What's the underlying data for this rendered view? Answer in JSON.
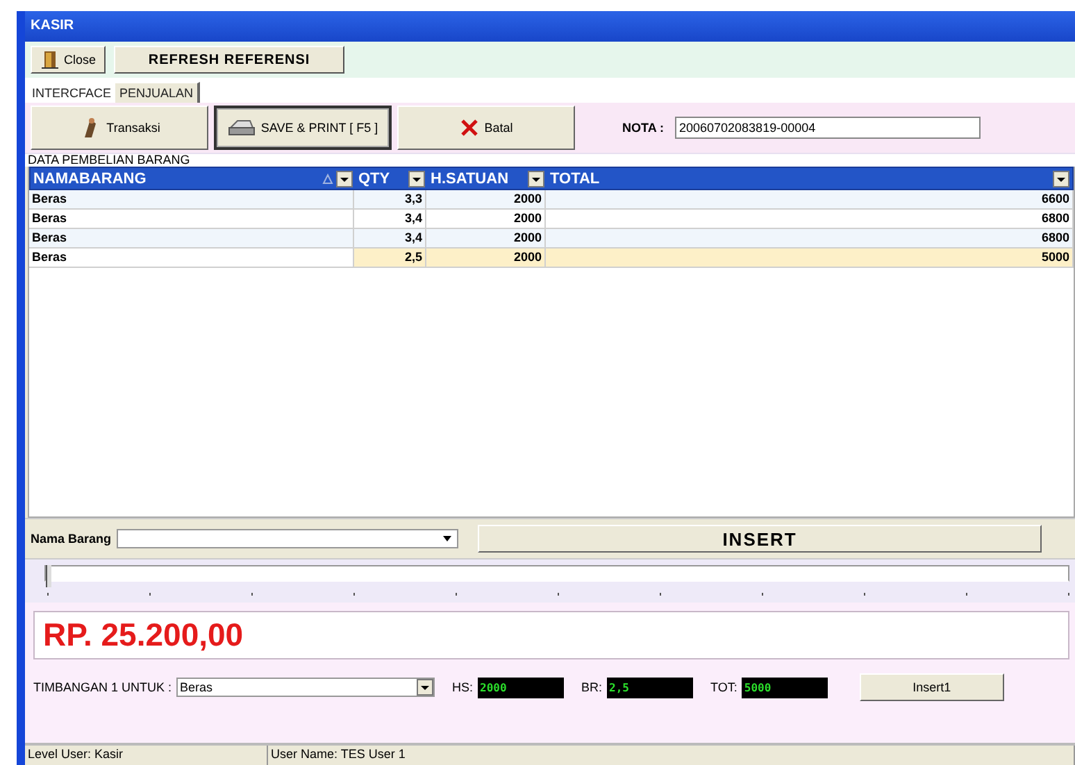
{
  "window": {
    "title": "KASIR"
  },
  "toolbar": [
    {
      "kind": "close",
      "label": "Close"
    },
    {
      "kind": "refresh",
      "label": "REFRESH REFERENSI"
    }
  ],
  "tabs": [
    {
      "label": "INTERCFACE",
      "selected": false
    },
    {
      "label": "PENJUALAN",
      "selected": true
    }
  ],
  "actions": [
    {
      "kind": "transaksi",
      "label": "Transaksi",
      "selected": false
    },
    {
      "kind": "print",
      "label": "SAVE &  PRINT [ F5 ]",
      "selected": true
    },
    {
      "kind": "batal",
      "label": "Batal",
      "selected": false
    }
  ],
  "nota": {
    "label": "NOTA :",
    "value": "20060702083819-00004"
  },
  "grid": {
    "caption": "DATA PEMBELIAN BARANG",
    "columns": [
      {
        "label": "NAMABARANG",
        "sorted": true
      },
      {
        "label": "QTY",
        "sorted": false
      },
      {
        "label": "H.SATUAN",
        "sorted": false
      },
      {
        "label": "TOTAL",
        "sorted": false
      }
    ],
    "rows": [
      {
        "cells": [
          "Beras",
          "3,3",
          "2000",
          "6600"
        ],
        "selected": false
      },
      {
        "cells": [
          "Beras",
          "3,4",
          "2000",
          "6800"
        ],
        "selected": false
      },
      {
        "cells": [
          "Beras",
          "3,4",
          "2000",
          "6800"
        ],
        "selected": false
      },
      {
        "cells": [
          "Beras",
          "2,5",
          "2000",
          "5000"
        ],
        "selected": true
      }
    ]
  },
  "entry": {
    "label": "Nama Barang",
    "insert": "INSERT"
  },
  "slider": {
    "level": 0
  },
  "grand_total": "RP. 25.200,00",
  "scale": {
    "label": "TIMBANGAN 1 UNTUK :",
    "item": "Beras",
    "readouts": [
      {
        "label": "HS:",
        "value": "2000"
      },
      {
        "label": "BR:",
        "value": "2,5"
      },
      {
        "label": "TOT:",
        "value": "5000"
      }
    ],
    "button": "Insert1"
  },
  "status_bar": [
    "Level User: Kasir",
    "User Name: TES User 1"
  ]
}
